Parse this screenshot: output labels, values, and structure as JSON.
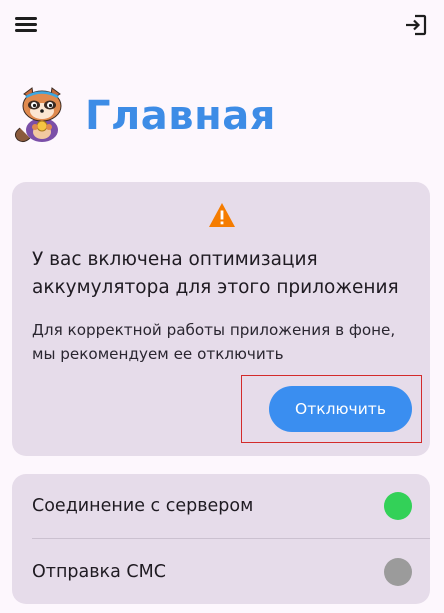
{
  "header": {
    "title": "Главная",
    "menu_icon": "hamburger-menu-icon",
    "logout_icon": "logout-icon",
    "avatar_icon": "raccoon-mascot-logo"
  },
  "warning": {
    "icon": "warning-triangle-icon",
    "icon_color": "#f57c00",
    "heading": "У вас включена оптимизация аккумулятора для этого приложения",
    "description": "Для корректной работы приложения в фоне, мы рекомендуем ее отключить",
    "button_label": "Отключить"
  },
  "status": {
    "items": [
      {
        "label": "Соединение с сервером",
        "state": "connected",
        "color": "#33d158"
      },
      {
        "label": "Отправка СМС",
        "state": "inactive",
        "color": "#9b9b9b"
      }
    ]
  },
  "colors": {
    "accent": "#3a8ef0",
    "title": "#3d8ce6",
    "card_background": "#e6dcea",
    "page_background": "#fdf7fd",
    "highlight_border": "#d32b2b"
  }
}
